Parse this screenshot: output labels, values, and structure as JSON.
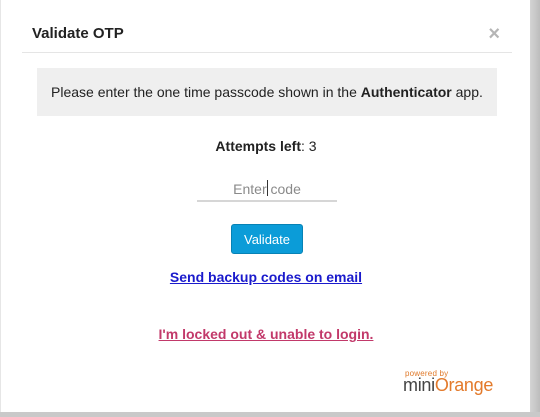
{
  "dialog": {
    "title": "Validate OTP",
    "close_glyph": "×"
  },
  "info": {
    "text_before": "Please enter the one time passcode shown in the ",
    "app_name": "Authenticator",
    "text_after": " app."
  },
  "attempts": {
    "label": "Attempts left",
    "separator": ": ",
    "value": "3"
  },
  "code_input": {
    "placeholder": "Enter code",
    "value": ""
  },
  "buttons": {
    "validate_label": "Validate"
  },
  "links": {
    "backup_codes": "Send backup codes on email",
    "locked_out": "I'm locked out & unable to login."
  },
  "branding": {
    "powered_by": "powered by",
    "name_part1": "mini",
    "name_part2": "Orange"
  },
  "colors": {
    "accent_button": "#0b9cd8",
    "link_blue": "#1a1acc",
    "link_pink": "#c2396a",
    "brand_orange": "#e37a2b"
  }
}
